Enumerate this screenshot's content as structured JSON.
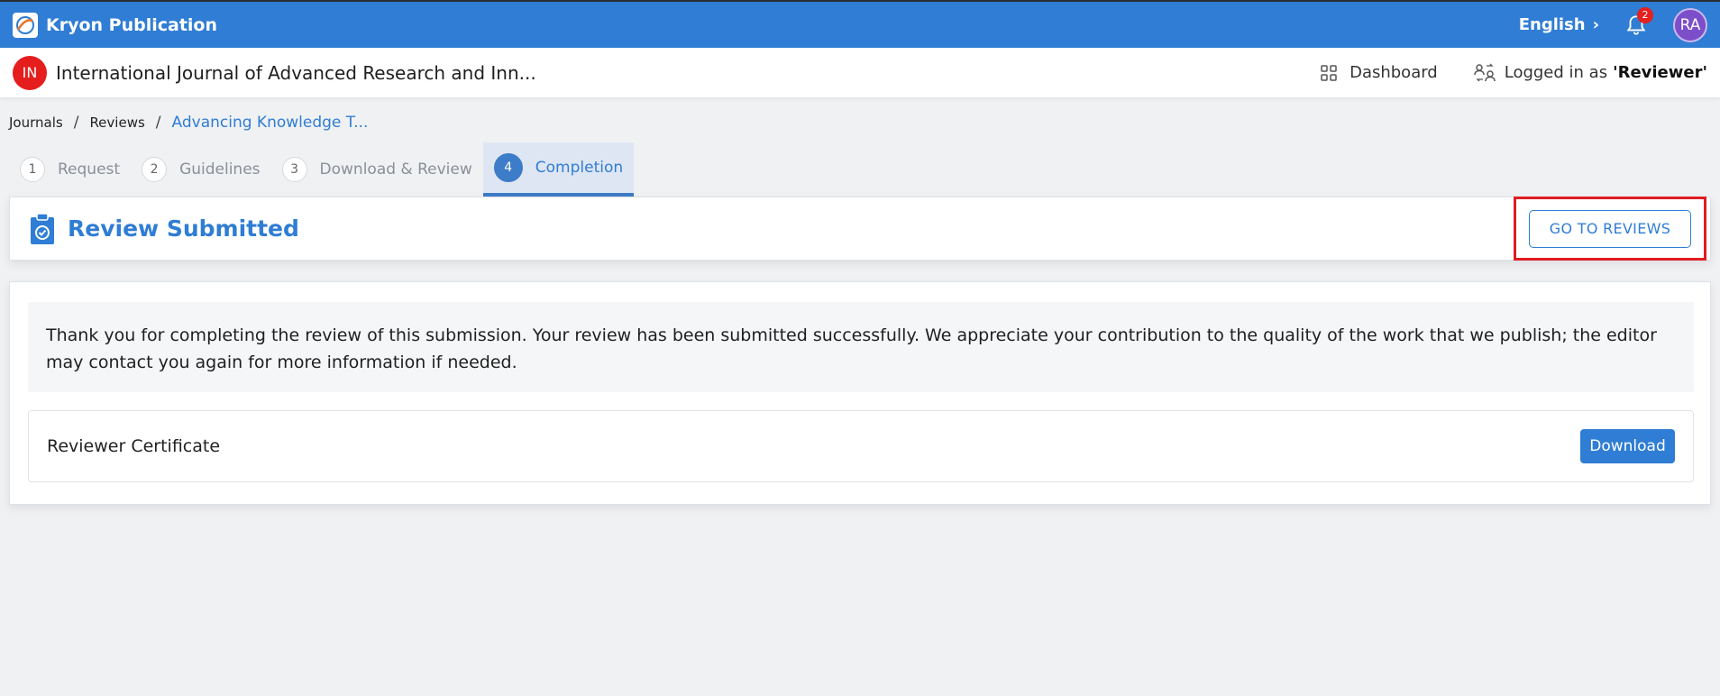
{
  "app": {
    "name": "Kryon Publication",
    "language": "English",
    "notification_count": "2",
    "user_initials": "RA"
  },
  "journal": {
    "badge": "IN",
    "title": "International Journal of Advanced Research and Inn..."
  },
  "nav": {
    "dashboard": "Dashboard",
    "logged_in_prefix": "Logged in as",
    "role": "'Reviewer'"
  },
  "breadcrumb": [
    "Journals",
    "Reviews",
    "Advancing Knowledge T..."
  ],
  "steps": [
    {
      "num": "1",
      "label": "Request"
    },
    {
      "num": "2",
      "label": "Guidelines"
    },
    {
      "num": "3",
      "label": "Download & Review"
    },
    {
      "num": "4",
      "label": "Completion"
    }
  ],
  "header": {
    "title": "Review Submitted",
    "goto_label": "GO TO REVIEWS"
  },
  "body": {
    "message": "Thank you for completing the review of this submission. Your review has been submitted successfully. We appreciate your contribution to the quality of the work that we publish; the editor may contact you again for more information if needed.",
    "certificate_label": "Reviewer Certificate",
    "download_label": "Download"
  },
  "colors": {
    "primary": "#2f7dd4",
    "highlight": "#e11b22",
    "badge": "#e61d1d",
    "avatar": "#7c4ec9"
  }
}
